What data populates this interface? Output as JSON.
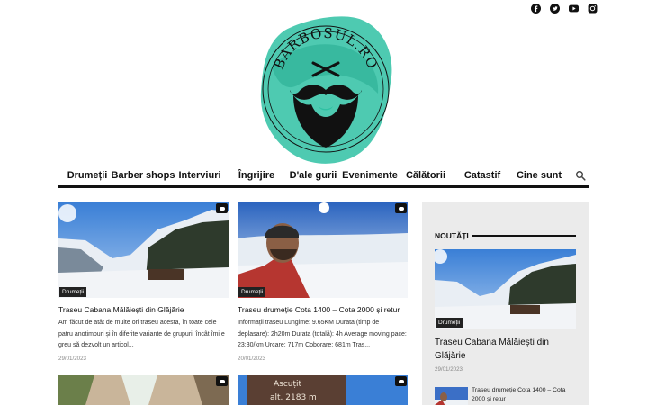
{
  "header": {
    "social_icons": [
      "facebook-icon",
      "twitter-icon",
      "youtube-icon",
      "instagram-icon"
    ],
    "logo_text": "BARBOSUL.RO",
    "logo_color": "#2fc1a3"
  },
  "nav": {
    "items": [
      "Drumeții",
      "Barber shops",
      "Interviuri",
      "Îngrijire",
      "D'ale gurii",
      "Evenimente",
      "Călătorii",
      "Catastif",
      "Cine sunt"
    ],
    "search_icon": "search-icon"
  },
  "posts": [
    {
      "category": "Drumeții",
      "title": "Traseu Cabana Mălăiești din Glăjărie",
      "excerpt": "Am făcut de atât de multe ori traseu acesta, în toate cele patru anotimpuri și în diferite variante de grupuri, încât îmi e greu să dezvolt un articol...",
      "date": "29/01/2023"
    },
    {
      "category": "Drumeții",
      "title": "Traseu drumeție Cota 1400 – Cota 2000 și retur",
      "excerpt": "Informații traseu Lungime: 9.65KM Durata (timp de deplasare): 2h20m Durata (totală): 4h Average moving pace: 23:30/km Urcare: 717m Coborare: 681m Tras...",
      "date": "20/01/2023"
    },
    {
      "image_sign": "Ascuțit",
      "image_sign2": "alt. 2183 m"
    }
  ],
  "sidebar": {
    "widget_title": "NOUTĂȚI",
    "featured": {
      "category": "Drumeții",
      "title": "Traseu Cabana Mălăiești din Glăjărie",
      "date": "29/01/2023"
    },
    "small_item": {
      "title": "Traseu drumeție Cota 1400 – Cota 2000 și retur"
    }
  }
}
